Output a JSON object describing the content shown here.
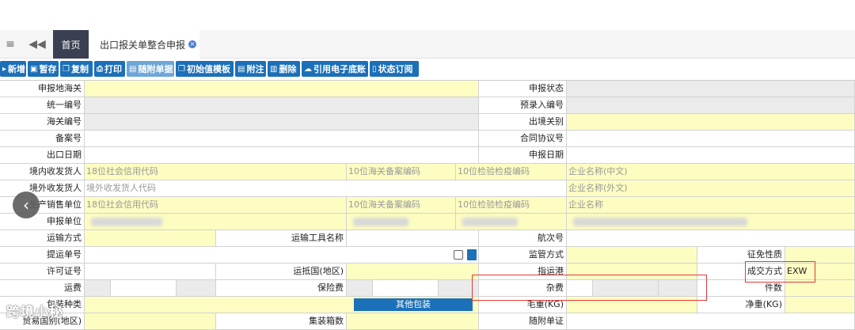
{
  "tabs": {
    "home": "首页",
    "current": "出口报关单整合申报",
    "close": "×"
  },
  "toolbar": {
    "new": "新增",
    "save": "暂存",
    "copy": "复制",
    "print": "打印",
    "attach": "随附单据",
    "init_tpl": "初始值模板",
    "note": "附注",
    "delete": "删除",
    "ref_ledger": "引用电子底账",
    "sub": "状态订阅"
  },
  "form": {
    "declare_customs": "申报地海关",
    "declare_status": "申报状态",
    "unified_no": "统一编号",
    "pre_entry_no": "预录入编号",
    "customs_no": "海关编号",
    "exit_customs": "出境关别",
    "record_no": "备案号",
    "contract_no": "合同协议号",
    "export_date": "出口日期",
    "declare_date": "申报日期",
    "domestic_consignor": "境内收发货人",
    "foreign_consignee": "境外收发货人",
    "production_unit": "生产销售单位",
    "declare_unit": "申报单位",
    "ph_credit": "18位社会信用代码",
    "ph_customs10": "10位海关备案编码",
    "ph_ciq10": "10位检验检疫编码",
    "ph_name_cn": "企业名称(中文)",
    "ph_foreign_code": "境外收发货人代码",
    "ph_name_en": "企业名称(外文)",
    "ph_name": "企业名称",
    "transport_mode": "运输方式",
    "vehicle_name": "运输工具名称",
    "voyage_no": "航次号",
    "bill_no": "提运单号",
    "supervision": "监管方式",
    "tax_nature": "征免性质",
    "license_no": "许可证号",
    "dest_country": "运抵国(地区)",
    "port": "指运港",
    "deal_mode": "成交方式",
    "deal_value": "EXW",
    "freight": "运费",
    "insurance": "保险费",
    "misc": "杂费",
    "pieces": "件数",
    "package_type": "包装种类",
    "other_pack": "其他包装",
    "gross_wt": "毛重(KG)",
    "net_wt": "净重(KG)",
    "trade_country": "贸易国别(地区)",
    "container_count": "集装箱数",
    "attached_doc": "随附单证"
  },
  "watermark": "跨境小秘",
  "icons": {
    "menu": "menu-icon",
    "back": "double-chevron-left-icon",
    "nav": "chevron-left-icon"
  }
}
